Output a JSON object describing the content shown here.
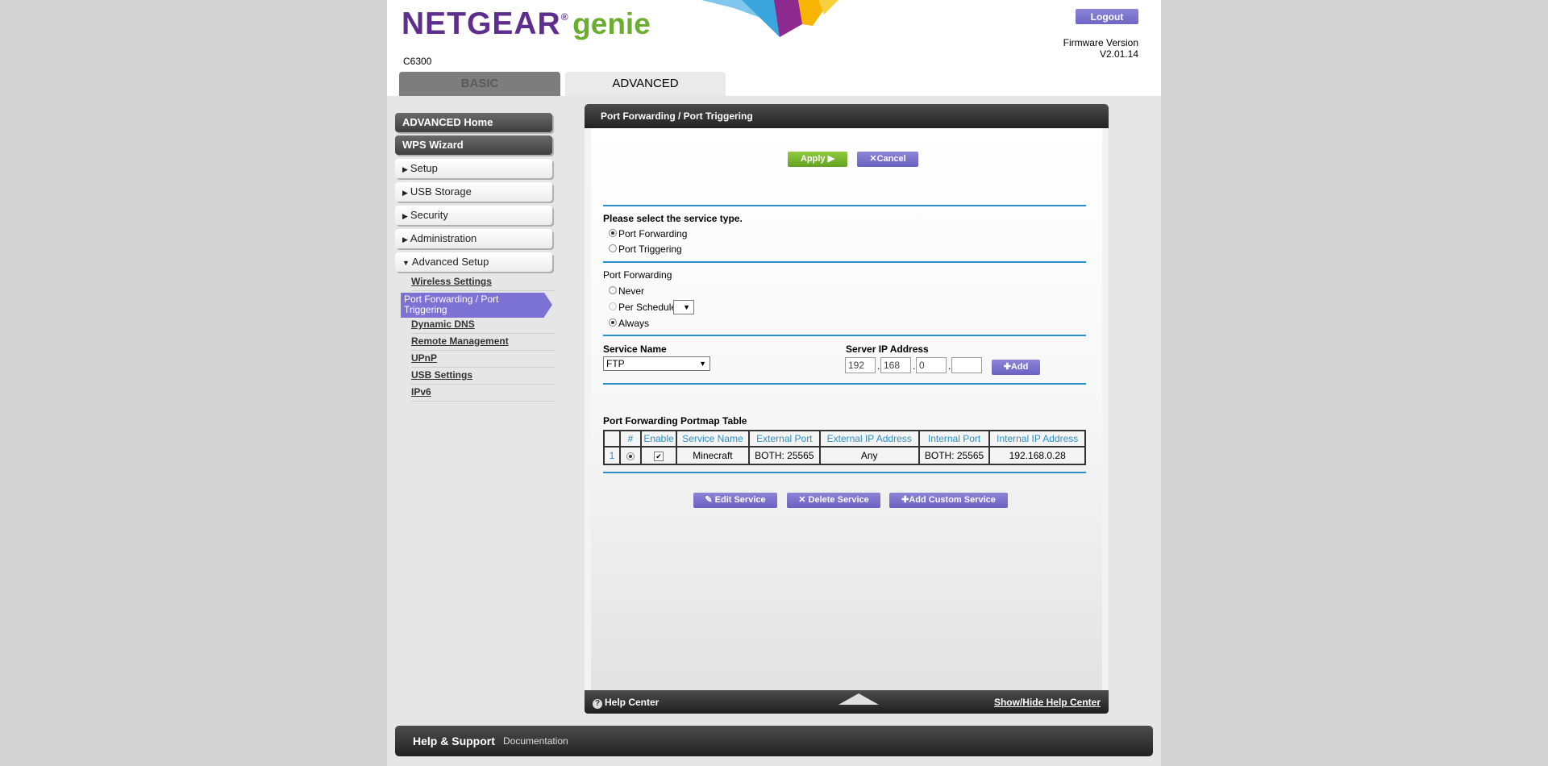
{
  "header": {
    "brand": "NETGEAR",
    "brand_reg": "®",
    "brand_suffix": "genie",
    "model": "C6300",
    "logout_label": "Logout",
    "firmware_label": "Firmware Version",
    "firmware_value": "V2.01.14",
    "tabs": [
      {
        "label": "BASIC",
        "active": false
      },
      {
        "label": "ADVANCED",
        "active": true
      }
    ]
  },
  "sidebar": {
    "primary": [
      {
        "label": "ADVANCED Home",
        "style": "dark"
      },
      {
        "label": "WPS Wizard",
        "style": "dark"
      },
      {
        "label": "Setup",
        "style": "light",
        "expanded": false
      },
      {
        "label": "USB Storage",
        "style": "light",
        "expanded": false
      },
      {
        "label": "Security",
        "style": "light",
        "expanded": false
      },
      {
        "label": "Administration",
        "style": "light",
        "expanded": false
      },
      {
        "label": "Advanced Setup",
        "style": "light",
        "expanded": true
      }
    ],
    "subitems": [
      {
        "label": "Wireless Settings"
      },
      {
        "label": "Port Forwarding / Port Triggering",
        "active": true
      },
      {
        "label": "Dynamic DNS"
      },
      {
        "label": "Remote Management"
      },
      {
        "label": "UPnP"
      },
      {
        "label": "USB Settings"
      },
      {
        "label": "IPv6"
      }
    ]
  },
  "panel": {
    "title": "Port Forwarding / Port Triggering",
    "apply_label": "Apply ▶",
    "cancel_label": "Cancel",
    "service_type_heading": "Please select the service type.",
    "service_type_options": [
      {
        "label": "Port Forwarding",
        "selected": true
      },
      {
        "label": "Port Triggering",
        "selected": false
      }
    ],
    "pf_heading": "Port Forwarding",
    "pf_options": [
      {
        "label": "Never",
        "selected": false
      },
      {
        "label": "Per Schedule",
        "selected": false
      },
      {
        "label": "Always",
        "selected": true
      }
    ],
    "schedule_select_value": "",
    "service_name_label": "Service Name",
    "service_name_value": "FTP",
    "server_ip_label": "Server IP Address",
    "server_ip": [
      "192",
      "168",
      "0",
      ""
    ],
    "add_label": "Add",
    "table_title": "Port Forwarding Portmap Table",
    "table_headers": [
      "",
      "#",
      "Enable",
      "Service Name",
      "External Port",
      "External IP Address",
      "Internal Port",
      "Internal IP Address"
    ],
    "table_rows": [
      {
        "index": "1",
        "selected": true,
        "enabled": true,
        "service_name": "Minecraft",
        "external_port": "BOTH: 25565",
        "external_ip": "Any",
        "internal_port": "BOTH: 25565",
        "internal_ip": "192.168.0.28"
      }
    ],
    "edit_label": "Edit Service",
    "delete_label": "Delete Service",
    "add_custom_label": "Add Custom Service",
    "help_center_label": "Help Center",
    "help_toggle_label": "Show/Hide Help Center"
  },
  "footer": {
    "support_title": "Help & Support",
    "documentation_label": "Documentation"
  },
  "colors": {
    "brand_purple": "#5e2e8f",
    "brand_green": "#6bae2f",
    "accent_purple": "#7b72d4",
    "rule_blue": "#2a8fc7",
    "apply_green": "#7cb82f"
  }
}
